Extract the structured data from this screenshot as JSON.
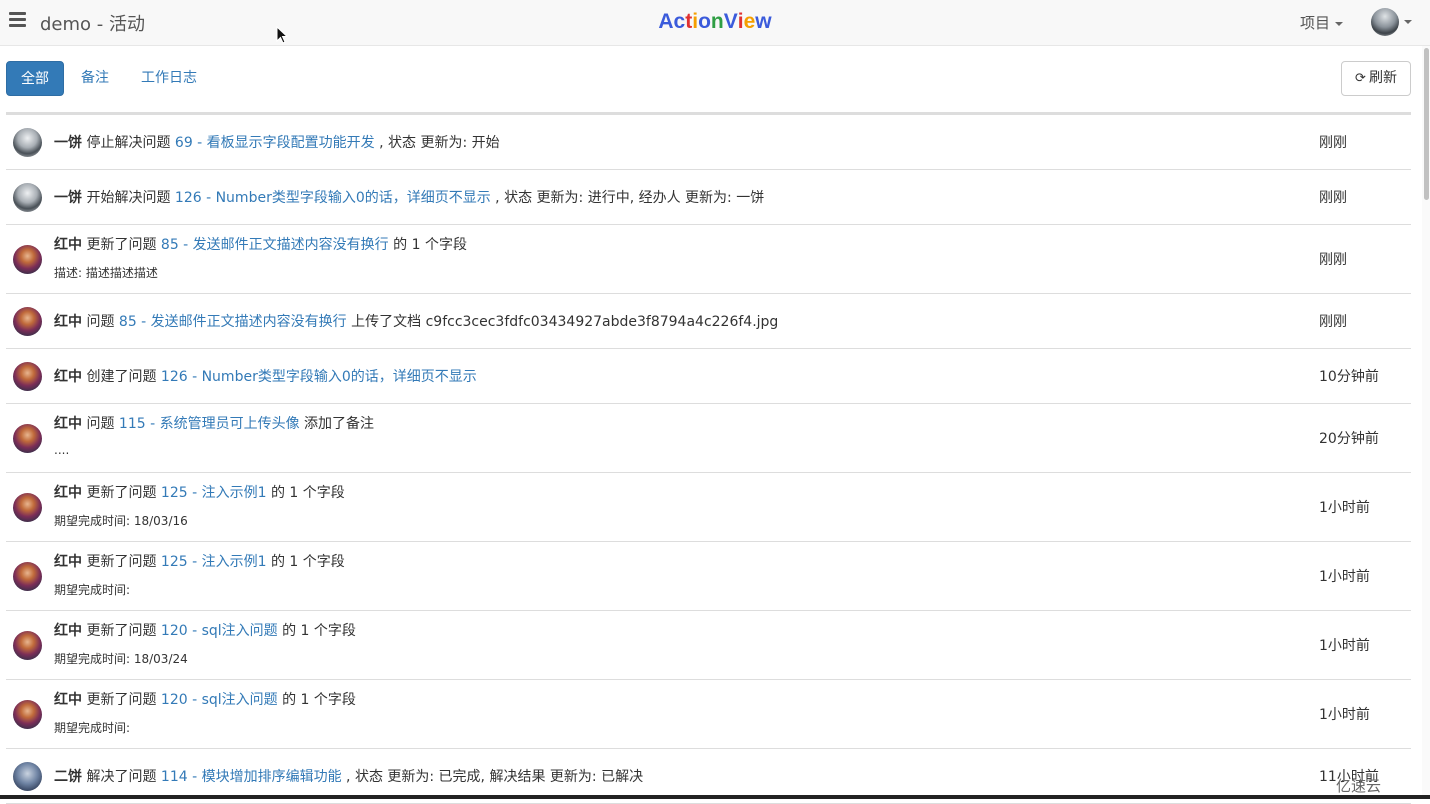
{
  "header": {
    "title": "demo - 活动",
    "logo": {
      "text": "ActionView",
      "letters": [
        {
          "ch": "A",
          "color": "#3b5bdb"
        },
        {
          "ch": "c",
          "color": "#3b5bdb"
        },
        {
          "ch": "t",
          "color": "#e03131"
        },
        {
          "ch": "i",
          "color": "#f59f00"
        },
        {
          "ch": "o",
          "color": "#3b5bdb"
        },
        {
          "ch": "n",
          "color": "#2f9e44"
        },
        {
          "ch": "V",
          "color": "#3b5bdb"
        },
        {
          "ch": "i",
          "color": "#e03131"
        },
        {
          "ch": "e",
          "color": "#f59f00"
        },
        {
          "ch": "w",
          "color": "#3b5bdb"
        }
      ]
    },
    "project_menu": "项目",
    "user_menu_icon": "avatar-icon"
  },
  "tabs": [
    {
      "label": "全部",
      "active": true
    },
    {
      "label": "备注",
      "active": false
    },
    {
      "label": "工作日志",
      "active": false
    }
  ],
  "refresh_label": "刷新",
  "activities": [
    {
      "user": "一饼",
      "avatar": "gray",
      "parts": [
        {
          "t": "text",
          "v": " 停止解决问题 "
        },
        {
          "t": "link",
          "v": "69 - 看板显示字段配置功能开发"
        },
        {
          "t": "text",
          "v": " , 状态 更新为: 开始"
        }
      ],
      "detail": "",
      "time": "刚刚"
    },
    {
      "user": "一饼",
      "avatar": "gray",
      "parts": [
        {
          "t": "text",
          "v": " 开始解决问题 "
        },
        {
          "t": "link",
          "v": "126 - Number类型字段输入0的话，详细页不显示"
        },
        {
          "t": "text",
          "v": " , 状态 更新为: 进行中, 经办人 更新为: 一饼"
        }
      ],
      "detail": "",
      "time": "刚刚"
    },
    {
      "user": "红中",
      "avatar": "red",
      "parts": [
        {
          "t": "text",
          "v": " 更新了问题 "
        },
        {
          "t": "link",
          "v": "85 - 发送邮件正文描述内容没有换行"
        },
        {
          "t": "text",
          "v": " 的 1 个字段"
        }
      ],
      "detail": "描述: 描述描述描述",
      "time": "刚刚"
    },
    {
      "user": "红中",
      "avatar": "red",
      "parts": [
        {
          "t": "text",
          "v": " 问题 "
        },
        {
          "t": "link",
          "v": "85 - 发送邮件正文描述内容没有换行"
        },
        {
          "t": "text",
          "v": " 上传了文档 c9fcc3cec3fdfc03434927abde3f8794a4c226f4.jpg"
        }
      ],
      "detail": "",
      "time": "刚刚"
    },
    {
      "user": "红中",
      "avatar": "red",
      "parts": [
        {
          "t": "text",
          "v": " 创建了问题 "
        },
        {
          "t": "link",
          "v": "126 - Number类型字段输入0的话，详细页不显示"
        }
      ],
      "detail": "",
      "time": "10分钟前"
    },
    {
      "user": "红中",
      "avatar": "red",
      "parts": [
        {
          "t": "text",
          "v": " 问题 "
        },
        {
          "t": "link",
          "v": "115 - 系统管理员可上传头像"
        },
        {
          "t": "text",
          "v": " 添加了备注"
        }
      ],
      "detail": "....",
      "time": "20分钟前"
    },
    {
      "user": "红中",
      "avatar": "red",
      "parts": [
        {
          "t": "text",
          "v": " 更新了问题 "
        },
        {
          "t": "link",
          "v": "125 - 注入示例1"
        },
        {
          "t": "text",
          "v": " 的 1 个字段"
        }
      ],
      "detail": "期望完成时间: 18/03/16",
      "time": "1小时前"
    },
    {
      "user": "红中",
      "avatar": "red",
      "parts": [
        {
          "t": "text",
          "v": " 更新了问题 "
        },
        {
          "t": "link",
          "v": "125 - 注入示例1"
        },
        {
          "t": "text",
          "v": " 的 1 个字段"
        }
      ],
      "detail": "期望完成时间:",
      "time": "1小时前"
    },
    {
      "user": "红中",
      "avatar": "red",
      "parts": [
        {
          "t": "text",
          "v": " 更新了问题 "
        },
        {
          "t": "link",
          "v": "120 - sql注入问题"
        },
        {
          "t": "text",
          "v": " 的 1 个字段"
        }
      ],
      "detail": "期望完成时间: 18/03/24",
      "time": "1小时前"
    },
    {
      "user": "红中",
      "avatar": "red",
      "parts": [
        {
          "t": "text",
          "v": " 更新了问题 "
        },
        {
          "t": "link",
          "v": "120 - sql注入问题"
        },
        {
          "t": "text",
          "v": " 的 1 个字段"
        }
      ],
      "detail": "期望完成时间:",
      "time": "1小时前"
    },
    {
      "user": "二饼",
      "avatar": "blue",
      "parts": [
        {
          "t": "text",
          "v": " 解决了问题 "
        },
        {
          "t": "link",
          "v": "114 - 模块增加排序编辑功能"
        },
        {
          "t": "text",
          "v": " , 状态 更新为: 已完成, 解决结果 更新为: 已解决"
        }
      ],
      "detail": "",
      "time": "11小时前"
    }
  ],
  "watermark": "亿速云"
}
